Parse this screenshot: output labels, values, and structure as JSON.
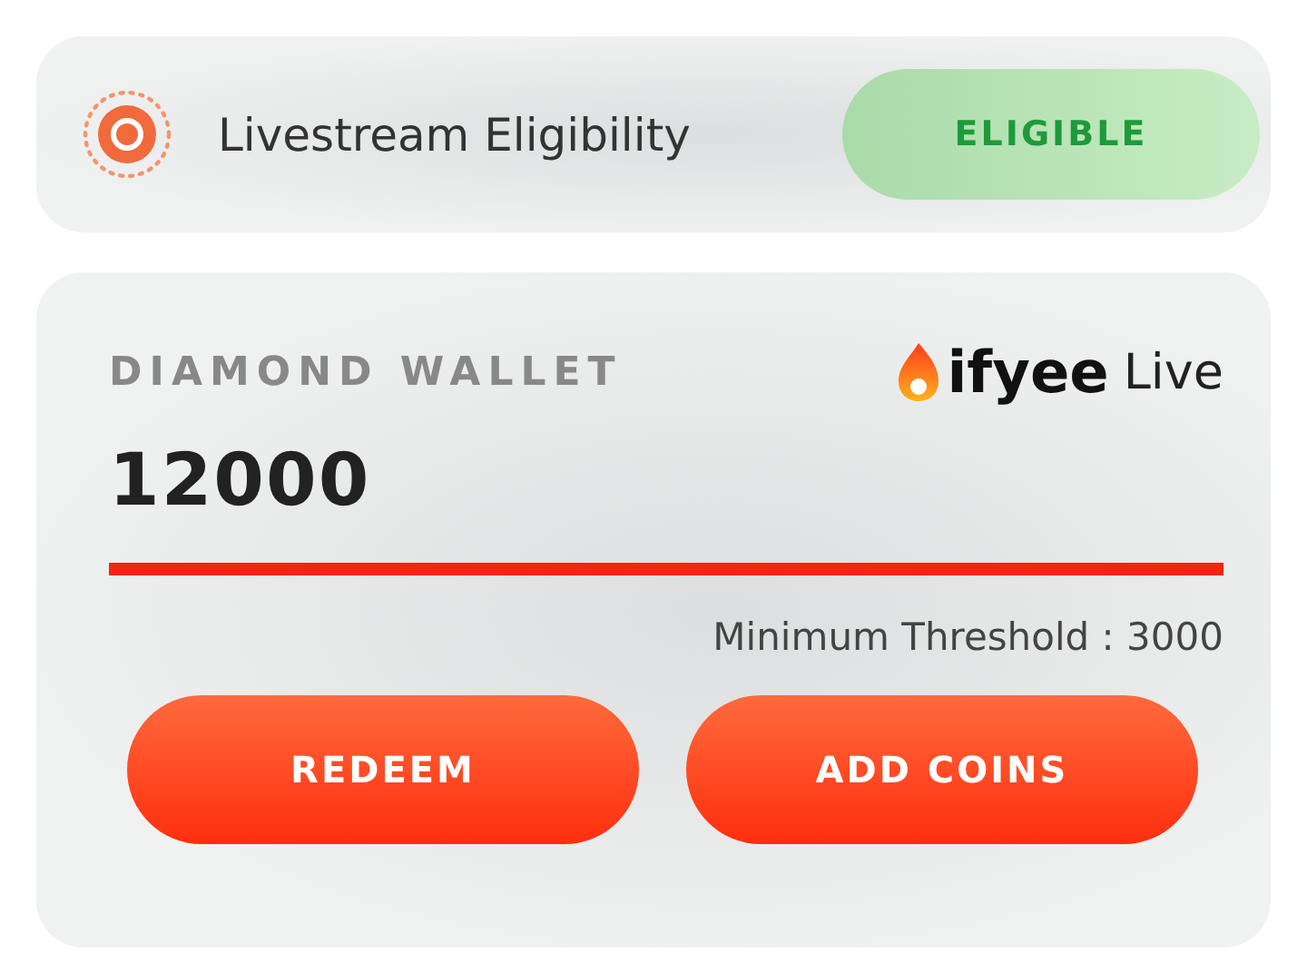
{
  "eligibility": {
    "label": "Livestream Eligibility",
    "status": {
      "label": "ELIGIBLE",
      "kind": "eligible"
    }
  },
  "wallet": {
    "title": "DIAMOND WALLET",
    "brand": {
      "name": "ifyee",
      "suffix": "Live"
    },
    "balance": "12000",
    "threshold": "Minimum Threshold : 3000"
  },
  "buttons": [
    {
      "label": "REDEEM"
    },
    {
      "label": "ADD COINS"
    }
  ]
}
